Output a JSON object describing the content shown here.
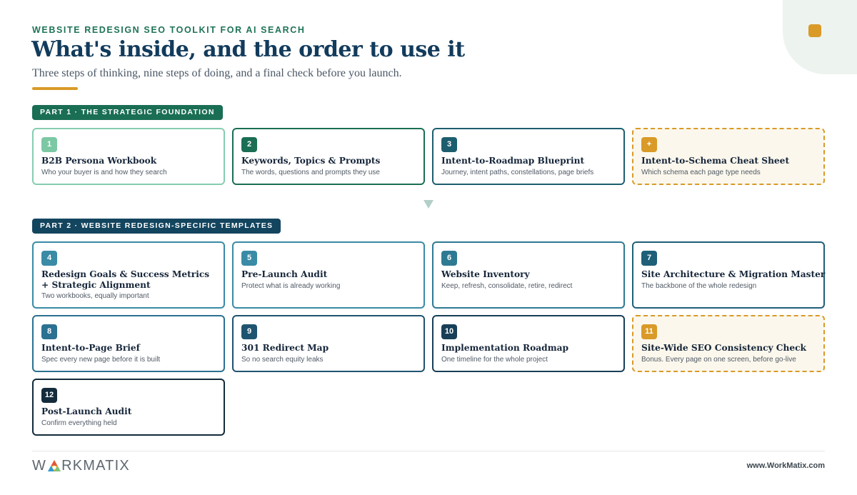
{
  "header": {
    "eyebrow": "WEBSITE REDESIGN SEO TOOLKIT FOR AI SEARCH",
    "title": "What's inside, and the order to use it",
    "subtitle": "Three steps of thinking, nine steps of doing, and a final check before you launch."
  },
  "parts": [
    {
      "label": "PART 1 · THE STRATEGIC FOUNDATION"
    },
    {
      "label": "PART 2 · WEBSITE REDESIGN-SPECIFIC TEMPLATES"
    }
  ],
  "cards": [
    {
      "num": "1",
      "title": "B2B Persona Workbook",
      "desc": "Who your buyer is and how they search",
      "color": "#7cc8a4"
    },
    {
      "num": "2",
      "title": "Keywords, Topics & Prompts",
      "desc": "The words, questions and prompts they use",
      "color": "#1a6e53"
    },
    {
      "num": "3",
      "title": "Intent-to-Roadmap Blueprint",
      "desc": "Journey, intent paths, constellations, page briefs",
      "color": "#1d5e6e"
    },
    {
      "num": "+",
      "title": "Intent-to-Schema Cheat Sheet",
      "desc": "Which schema each page type needs",
      "color": "#d99a28"
    },
    {
      "num": "4",
      "title": "Redesign Goals & Success Metrics",
      "title2": "+ Strategic Alignment",
      "desc": "Two workbooks, equally important",
      "color": "#3a8ba6"
    },
    {
      "num": "5",
      "title": "Pre-Launch Audit",
      "desc": "Protect what is already working",
      "color": "#3a8ba6"
    },
    {
      "num": "6",
      "title": "Website Inventory",
      "desc": "Keep, refresh, consolidate, retire, redirect",
      "color": "#2f7a93"
    },
    {
      "num": "7",
      "title": "Site Architecture & Migration Master",
      "desc": "The backbone of the whole redesign",
      "color": "#1f5f78"
    },
    {
      "num": "8",
      "title": "Intent-to-Page Brief",
      "desc": "Spec every new page before it is built",
      "color": "#2b7191"
    },
    {
      "num": "9",
      "title": "301 Redirect Map",
      "desc": "So no search equity leaks",
      "color": "#1f5470"
    },
    {
      "num": "10",
      "title": "Implementation Roadmap",
      "desc": "One timeline for the whole project",
      "color": "#183f57"
    },
    {
      "num": "11",
      "title": "Site-Wide SEO Consistency Check",
      "desc": "Bonus. Every page on one screen, before go-live",
      "color": "#d99a28"
    },
    {
      "num": "12",
      "title": "Post-Launch Audit",
      "desc": "Confirm everything held",
      "color": "#142b3c"
    }
  ],
  "footer": {
    "logo_text_left": "W",
    "logo_text_right": "RKMATIX",
    "url": "www.WorkMatix.com"
  }
}
